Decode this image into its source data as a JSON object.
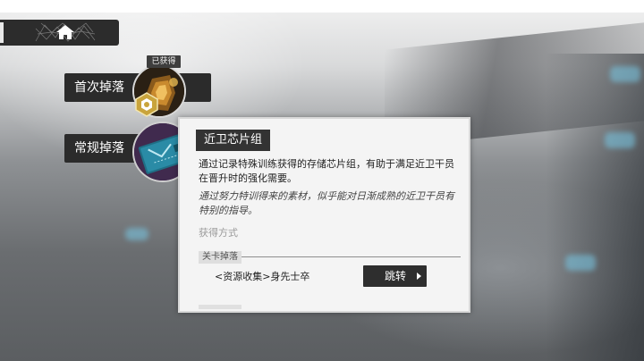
{
  "nav": {
    "home_icon": "home-icon"
  },
  "drops": {
    "first": {
      "label": "首次掉落",
      "obtained_tag": "已获得"
    },
    "regular": {
      "label": "常规掉落"
    }
  },
  "item": {
    "name": "近卫芯片组",
    "description": "通过记录特殊训练获得的存储芯片组，有助于满足近卫干员在晋升时的强化需要。",
    "flavor": "通过努力特训得来的素材，似乎能对日渐成熟的近卫干员有特别的指导。",
    "acquire_label": "获得方式",
    "stage_drop_label": "关卡掉落",
    "stage_name": "<资源收集>身先士卒",
    "jump_label": "跳转"
  },
  "colors": {
    "panel": "#2b2b2b",
    "popup": "#f4f4f4",
    "chip_teal": "#1f6f86",
    "gold": "#c9a43c"
  }
}
